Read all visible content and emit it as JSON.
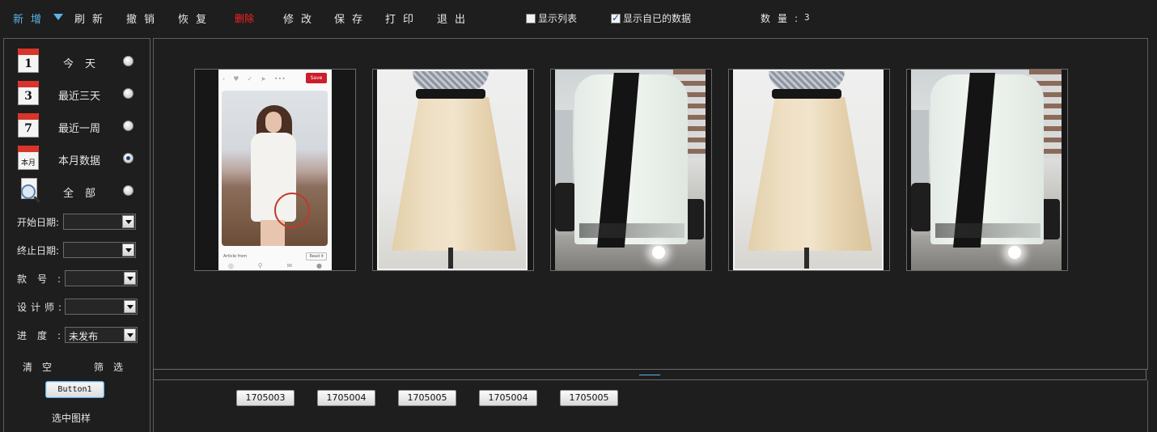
{
  "toolbar": {
    "add": "新增",
    "refresh": "刷新",
    "undo": "撤销",
    "restore": "恢复",
    "delete": "删除",
    "edit": "修改",
    "save": "保存",
    "print": "打印",
    "exit": "退出",
    "show_list": "显示列表",
    "show_list_checked": false,
    "show_own_data": "显示自已的数据",
    "show_own_data_checked": true,
    "count_label": "数量:",
    "count_value": "3",
    "accent_color": "#5ab4e8",
    "delete_color": "#ff2020"
  },
  "filters": {
    "ranges": [
      {
        "icon": "calendar-1-icon",
        "icon_text": "1",
        "label": "今天",
        "selected": false
      },
      {
        "icon": "calendar-3-icon",
        "icon_text": "3",
        "label": "最近三天",
        "selected": false
      },
      {
        "icon": "calendar-7-icon",
        "icon_text": "7",
        "label": "最近一周",
        "selected": false
      },
      {
        "icon": "calendar-month-icon",
        "icon_text": "本月",
        "label": "本月数据",
        "selected": true
      },
      {
        "icon": "magnifier-icon",
        "icon_text": "",
        "label": "全部",
        "selected": false
      }
    ],
    "start_date_label": "开始日期:",
    "start_date_value": "",
    "end_date_label": "终止日期:",
    "end_date_value": "",
    "style_no_label": "款号:",
    "style_no_value": "",
    "designer_label": "设计师:",
    "designer_value": "",
    "progress_label": "进度:",
    "progress_value": "未发布",
    "clear_label": "清空",
    "filter_label": "筛选",
    "button1_label": "Button1",
    "selected_pattern_label": "选中图样"
  },
  "gallery": {
    "thumbnails": [
      {
        "kind": "phone-screenshot",
        "save_label": "Save",
        "read_label": "Read it",
        "caption": "Article from"
      },
      {
        "kind": "skirt"
      },
      {
        "kind": "jacket"
      },
      {
        "kind": "skirt"
      },
      {
        "kind": "jacket"
      }
    ]
  },
  "codes": [
    "1705003",
    "1705004",
    "1705005",
    "1705004",
    "1705005"
  ]
}
